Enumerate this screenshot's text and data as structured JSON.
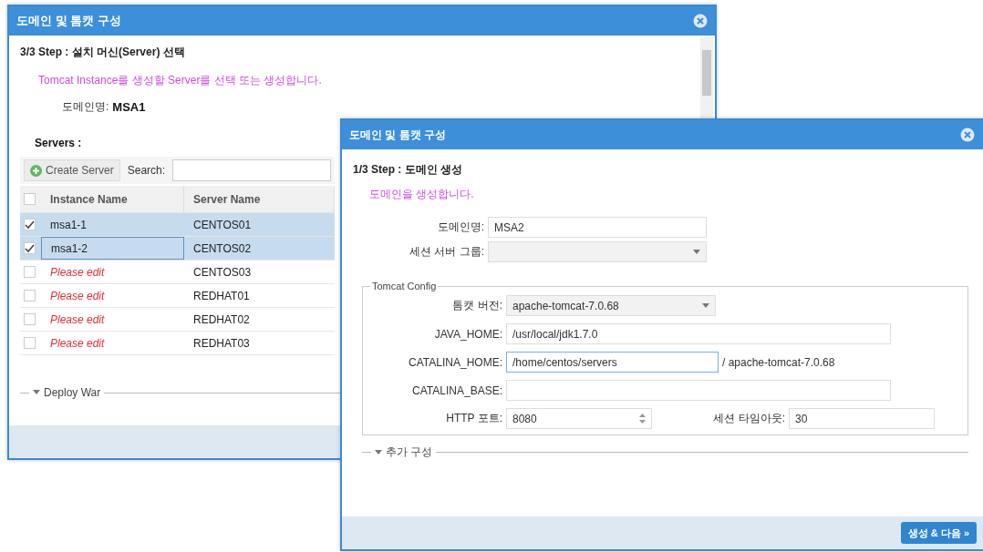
{
  "back_window": {
    "title": "도메인 및 톰캣 구성",
    "step": "3/3 Step : 설치 머신(Server) 선택",
    "description": "Tomcat Instance를 생성할 Server를 선택 또는 생성합니다.",
    "domain_label": "도메인명:",
    "domain_value": "MSA1",
    "servers_label": "Servers :",
    "create_button": "Create Server",
    "search_label": "Search:",
    "table": {
      "columns": [
        "Instance Name",
        "Server Name"
      ],
      "all_checked": false,
      "rows": [
        {
          "instance": "msa1-1",
          "server": "CENTOS01",
          "checked": true,
          "selected": true,
          "kind": "value",
          "editing": false
        },
        {
          "instance": "msa1-2",
          "server": "CENTOS02",
          "checked": true,
          "selected": true,
          "kind": "value",
          "editing": true
        },
        {
          "instance": "Please edit",
          "server": "CENTOS03",
          "checked": false,
          "selected": false,
          "kind": "placeholder",
          "editing": false
        },
        {
          "instance": "Please edit",
          "server": "REDHAT01",
          "checked": false,
          "selected": false,
          "kind": "placeholder",
          "editing": false
        },
        {
          "instance": "Please edit",
          "server": "REDHAT02",
          "checked": false,
          "selected": false,
          "kind": "placeholder",
          "editing": false
        },
        {
          "instance": "Please edit",
          "server": "REDHAT03",
          "checked": false,
          "selected": false,
          "kind": "placeholder",
          "editing": false
        }
      ]
    },
    "section": "Deploy War"
  },
  "front_window": {
    "title": "도메인 및 톰캣 구성",
    "step": "1/3 Step : 도메인 생성",
    "description": "도메인을 생성합니다.",
    "domain": {
      "label": "도메인명:",
      "value": "MSA2"
    },
    "session_group": {
      "label": "세션 서버 그룹:",
      "disabled": true
    },
    "tomcat_config": {
      "legend": "Tomcat Config",
      "version": {
        "label": "톰캣 버전:",
        "value": "apache-tomcat-7.0.68"
      },
      "java_home": {
        "label": "JAVA_HOME:",
        "value": "/usr/local/jdk1.7.0"
      },
      "catalina_home": {
        "label": "CATALINA_HOME:",
        "value": "/home/centos/servers",
        "suffix": "/ apache-tomcat-7.0.68",
        "focused": true
      },
      "catalina_base": {
        "label": "CATALINA_BASE:"
      },
      "http_port": {
        "label": "HTTP 포트:",
        "value": "8080"
      },
      "session_timeout": {
        "label": "세션 타임아웃:",
        "value": "30"
      }
    },
    "extra_section": "추가 구성",
    "next_button": "생성 & 다음 »"
  }
}
